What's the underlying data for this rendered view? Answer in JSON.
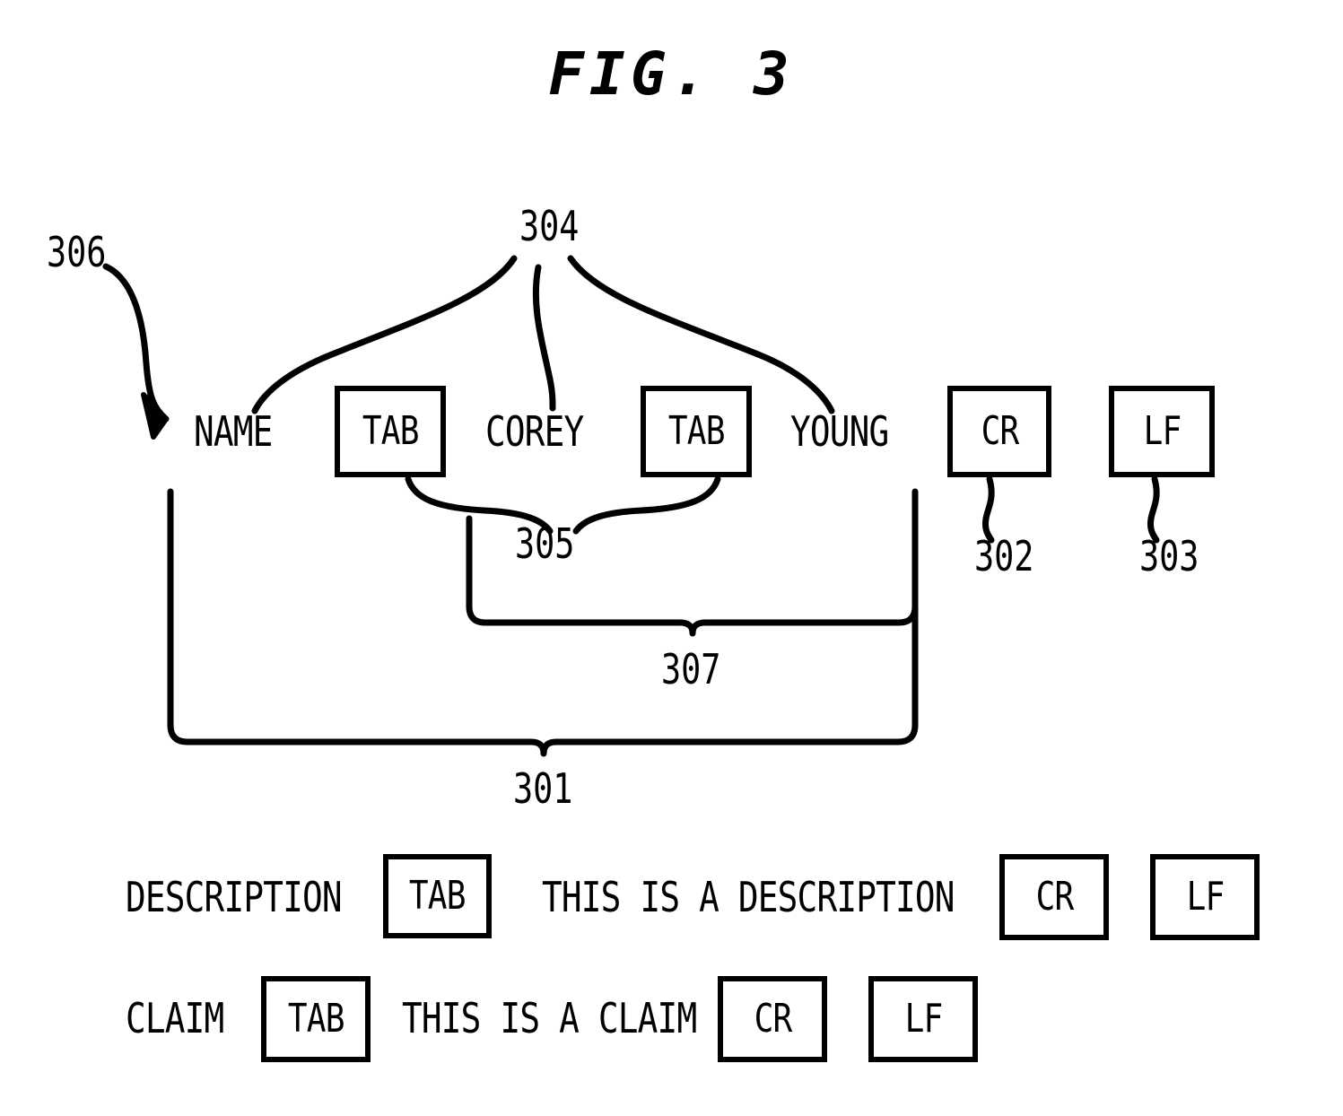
{
  "figure": {
    "title": "FIG. 3",
    "domain": "patent-diagram",
    "background_color": "#ffffff",
    "ink_color": "#000000"
  },
  "record_row": {
    "name_label": "NAME",
    "tab_1": "TAB",
    "first_name": "COREY",
    "tab_2": "TAB",
    "last_name": "YOUNG",
    "cr": "CR",
    "lf": "LF"
  },
  "description_row": {
    "field_label": "DESCRIPTION",
    "tab": "TAB",
    "value": "THIS IS A DESCRIPTION",
    "cr": "CR",
    "lf": "LF"
  },
  "claim_row": {
    "field_label": "CLAIM",
    "tab": "TAB",
    "value": "THIS IS A CLAIM",
    "cr": "CR",
    "lf": "LF"
  },
  "reference_numerals": {
    "record": "301",
    "carriage_return": "302",
    "line_feed": "303",
    "data_fields": "304",
    "delimiters": "305",
    "field_name": "306",
    "field_group": "307"
  }
}
